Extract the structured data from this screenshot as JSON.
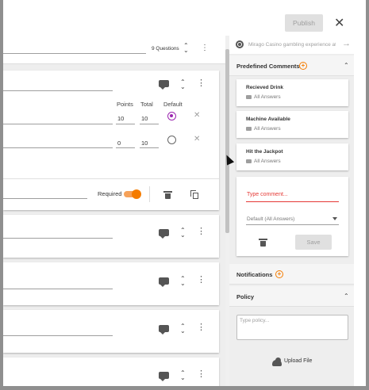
{
  "header": {
    "publish_label": "Publish",
    "close_symbol": "✕"
  },
  "questions_bar": {
    "count_label": "9 Questions"
  },
  "question_card": {
    "columns": {
      "points": "Points",
      "total": "Total",
      "default": "Default"
    },
    "answers": [
      {
        "points": "10",
        "total": "10",
        "default_selected": true
      },
      {
        "points": "0",
        "total": "10",
        "default_selected": false
      }
    ],
    "required_label": "Required",
    "required_on": true
  },
  "preview_question": {
    "text": "Mirago Casino gambling experience at"
  },
  "predefined_comments": {
    "title": "Predefined Comments",
    "items": [
      {
        "title": "Recieved Drink",
        "scope": "All Answers"
      },
      {
        "title": "Machine Available",
        "scope": "All Answers"
      },
      {
        "title": "Hit the Jackpot",
        "scope": "All Answers"
      }
    ],
    "new_comment_placeholder": "Type comment...",
    "scope_select": "Default (All Answers)",
    "save_label": "Save"
  },
  "notifications": {
    "title": "Notifications"
  },
  "policy": {
    "title": "Policy",
    "placeholder": "Type policy...",
    "upload_label": "Upload File"
  },
  "colors": {
    "accent": "#f57c00",
    "radio_selected": "#9c27b0",
    "error": "#e53935"
  }
}
